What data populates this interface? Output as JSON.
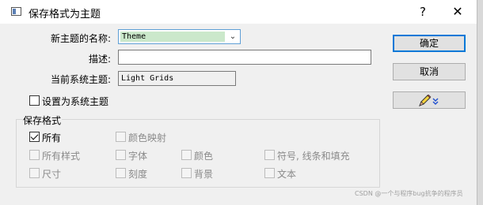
{
  "window": {
    "title": "保存格式为主题",
    "help_glyph": "?",
    "close_glyph": "✕"
  },
  "form": {
    "name_label": "新主题的名称:",
    "name_value": "Theme",
    "desc_label": "描述:",
    "desc_value": "",
    "current_label": "当前系统主题:",
    "current_value": "Light Grids",
    "set_system_label": "设置为系统主题",
    "set_system_checked": false
  },
  "buttons": {
    "ok": "确定",
    "cancel": "取消",
    "format_icon": "pen-icon"
  },
  "group": {
    "title": "保存格式",
    "options": {
      "all": "所有",
      "color_map": "颜色映射",
      "all_styles": "所有样式",
      "font": "字体",
      "color": "颜色",
      "symbols": "符号, 线条和填充",
      "size": "尺寸",
      "ticks": "刻度",
      "background": "背景",
      "text": "文本"
    }
  },
  "watermark": "CSDN @一个与程序bug抗争的程序员"
}
